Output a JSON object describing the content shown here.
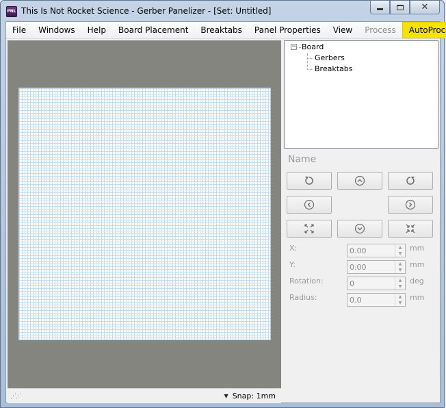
{
  "window": {
    "title": "This Is Not Rocket Science - Gerber Panelizer - [Set: Untitled]",
    "app_icon_text": "PNL",
    "buttons": {
      "minimize": "minimize",
      "maximize": "maximize",
      "close": "✕"
    }
  },
  "menu": {
    "items": [
      {
        "label": "File",
        "state": "normal"
      },
      {
        "label": "Windows",
        "state": "normal"
      },
      {
        "label": "Help",
        "state": "normal"
      },
      {
        "label": "Board Placement",
        "state": "normal"
      },
      {
        "label": "Breaktabs",
        "state": "normal"
      },
      {
        "label": "Panel Properties",
        "state": "normal"
      },
      {
        "label": "View",
        "state": "normal"
      },
      {
        "label": "Process",
        "state": "disabled"
      },
      {
        "label": "AutoProcess",
        "state": "highlighted"
      }
    ],
    "highlight_color": "#f5e300"
  },
  "canvas": {
    "background_color": "#858580",
    "grid_color": "#c3dcef"
  },
  "statusbar": {
    "snap_label": "Snap: 1mm"
  },
  "tree": {
    "root": {
      "label": "Board",
      "toggle": "−"
    },
    "children": [
      {
        "label": "Gerbers"
      },
      {
        "label": "Breaktabs"
      }
    ]
  },
  "properties": {
    "name_label": "Name",
    "fields": [
      {
        "label": "X:",
        "value": "0.00",
        "unit": "mm"
      },
      {
        "label": "Y:",
        "value": "0.00",
        "unit": "mm"
      },
      {
        "label": "Rotation:",
        "value": "0",
        "unit": "deg"
      },
      {
        "label": "Radius:",
        "value": "0.0",
        "unit": "mm"
      }
    ]
  }
}
